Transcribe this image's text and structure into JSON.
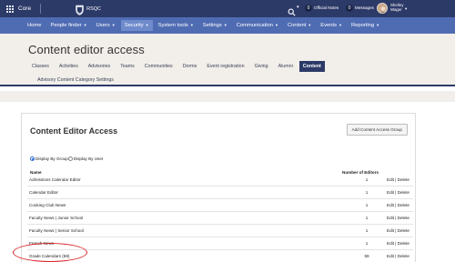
{
  "topbar": {
    "app_label": "Core",
    "school_name": "RSQC",
    "school_subtitle": "",
    "notes_count": "0",
    "notes_label": "Official Notes",
    "messages_count": "0",
    "messages_label": "Messages",
    "user_first": "Shelley",
    "user_last": "Wager"
  },
  "nav": {
    "items": [
      {
        "label": "Home"
      },
      {
        "label": "People finder"
      },
      {
        "label": "Users"
      },
      {
        "label": "Security"
      },
      {
        "label": "System tools"
      },
      {
        "label": "Settings"
      },
      {
        "label": "Communication"
      },
      {
        "label": "Content"
      },
      {
        "label": "Events"
      },
      {
        "label": "Reporting"
      }
    ]
  },
  "header": {
    "title": "Content editor access",
    "tabs": [
      {
        "label": "Classes"
      },
      {
        "label": "Activities"
      },
      {
        "label": "Advisories"
      },
      {
        "label": "Teams"
      },
      {
        "label": "Communities"
      },
      {
        "label": "Dorms"
      },
      {
        "label": "Event registration"
      },
      {
        "label": "Giving"
      },
      {
        "label": "Alumni"
      },
      {
        "label": "Content"
      }
    ],
    "subtab": "Advisory Content Category Settings"
  },
  "panel": {
    "title": "Content Editor Access",
    "add_button": "Add Content Access Group",
    "radio_group": "Display By Group",
    "radio_user": "Display By User",
    "col_name": "Name",
    "col_count": "Number of Editors",
    "rows": [
      {
        "name": "Admissions Calendar Editor",
        "count": "1",
        "actions": "Edit | Delete"
      },
      {
        "name": "Calendar Editor",
        "count": "1",
        "actions": "Edit | Delete"
      },
      {
        "name": "Cooking Club News",
        "count": "1",
        "actions": "Edit | Delete"
      },
      {
        "name": "Faculty News | Junior School",
        "count": "1",
        "actions": "Edit | Delete"
      },
      {
        "name": "Faculty News | Senior School",
        "count": "1",
        "actions": "Edit | Delete"
      },
      {
        "name": "French News",
        "count": "1",
        "actions": "Edit | Delete"
      },
      {
        "name": "Grade Calendars (59)",
        "count": "59",
        "actions": "Edit | Delete"
      }
    ]
  },
  "colors": {
    "topbar": "#2c3a68",
    "nav": "#4f6cb3",
    "header_bg": "#f2eeea",
    "active_tab": "#2c3a68",
    "highlight": "#d8262a"
  }
}
